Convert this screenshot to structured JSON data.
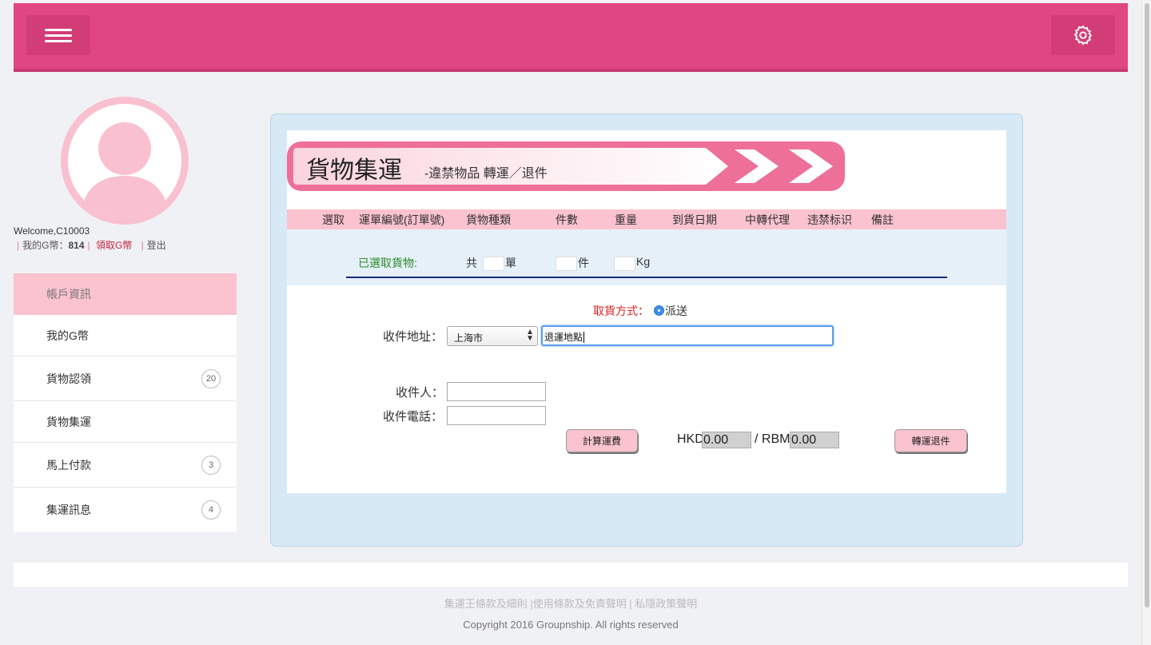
{
  "colors": {
    "brand": "#e04683",
    "pink_light": "#fbc2cf",
    "panel": "#d8e9f6"
  },
  "header": {
    "menu_icon": "hamburger-icon",
    "settings_icon": "gear-icon"
  },
  "user": {
    "welcome": "Welcome,C10003",
    "coins_label": "我的G幣：",
    "coins_value": "814",
    "claim_link": "領取G幣",
    "logout_link": "登出"
  },
  "sidebar": {
    "items": [
      {
        "label": "帳戶資訊"
      },
      {
        "label": "我的G幣"
      },
      {
        "label": "貨物認領",
        "badge": "20"
      },
      {
        "label": "貨物集運"
      },
      {
        "label": "馬上付款",
        "badge": "3"
      },
      {
        "label": "集運訊息",
        "badge": "4"
      }
    ]
  },
  "banner": {
    "title": "貨物集運",
    "subtitle": "-違禁物品 轉運／退件"
  },
  "table": {
    "headers": [
      "選取",
      "運單編號(訂單號)",
      "貨物種類",
      "件數",
      "重量",
      "到貨日期",
      "中轉代理",
      "违禁标识",
      "備註"
    ]
  },
  "selected": {
    "label": "已選取貨物:",
    "total_prefix": "共",
    "orders_unit": "單",
    "pieces_unit": "件",
    "weight_unit": "Kg"
  },
  "form": {
    "pickup_label": "取貨方式：",
    "pickup_option": "派送",
    "address_label": "收件地址：",
    "city_select": "上海市",
    "address_value": "退運地點",
    "recipient_label": "收件人：",
    "phone_label": "收件電話：",
    "calc_button": "計算運費",
    "hkd_label": "HKD",
    "hkd_value": "0.00",
    "rbm_label": "/ RBM",
    "rbm_value": "0.00",
    "return_button": "轉運退件"
  },
  "footer": {
    "links": "集運王條款及細則 |使用條款及免責聲明 | 私隱政策聲明",
    "copyright": "Copyright 2016 Groupnship. All rights reserved"
  }
}
